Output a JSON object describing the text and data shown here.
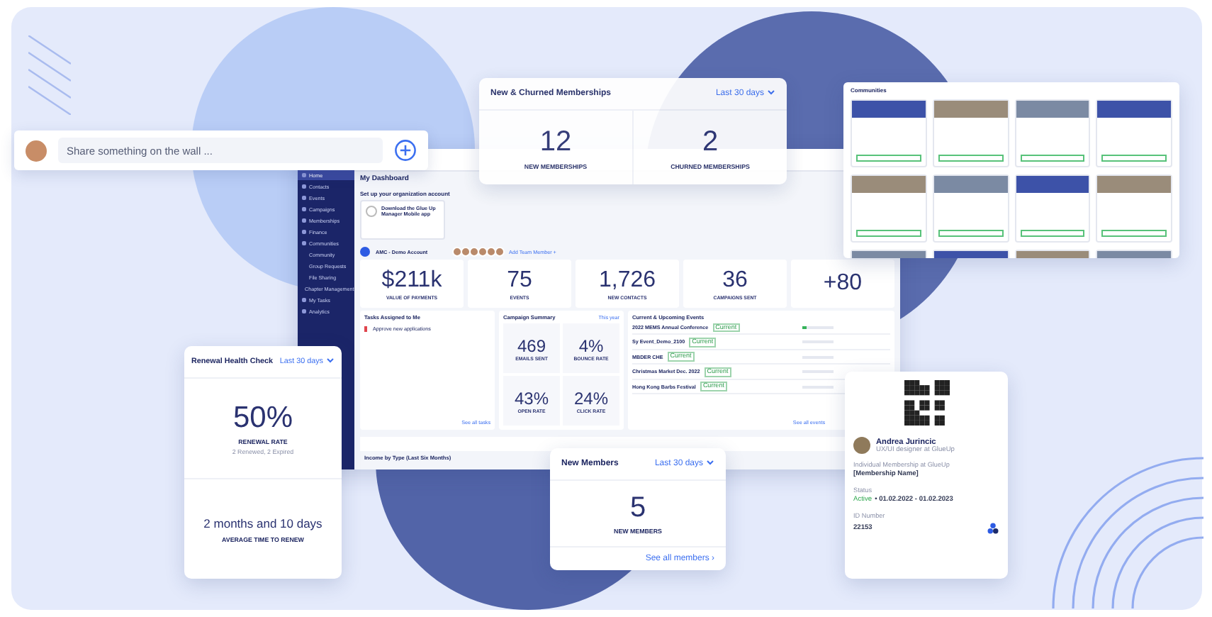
{
  "wall_post": {
    "placeholder": "Share something on the wall ..."
  },
  "churn_card": {
    "title": "New & Churned Memberships",
    "period": "Last 30 days",
    "stats": [
      {
        "value": "12",
        "label": "NEW MEMBERSHIPS"
      },
      {
        "value": "2",
        "label": "CHURNED MEMBERSHIPS"
      }
    ]
  },
  "dashboard": {
    "sidebar": {
      "items": [
        {
          "label": "Home",
          "selected": true
        },
        {
          "label": "Contacts",
          "selected": false
        },
        {
          "label": "Events",
          "selected": false
        },
        {
          "label": "Campaigns",
          "selected": false
        },
        {
          "label": "Memberships",
          "selected": false
        },
        {
          "label": "Finance",
          "selected": false
        },
        {
          "label": "Communities",
          "selected": false,
          "children": [
            {
              "label": "Community"
            },
            {
              "label": "Group Requests"
            },
            {
              "label": "File Sharing"
            }
          ]
        },
        {
          "label": "Chapter Management",
          "selected": false
        },
        {
          "label": "My Tasks",
          "selected": false
        },
        {
          "label": "Analytics",
          "selected": false
        }
      ]
    },
    "title": "My Dashboard",
    "setup": {
      "title": "Set up your organization account",
      "task": "Download the Glue Up Manager Mobile app"
    },
    "account": {
      "name": "AMC - Demo Account",
      "add_member": "Add Team Member +"
    },
    "stats": [
      {
        "value": "$211k",
        "label": "VALUE OF PAYMENTS"
      },
      {
        "value": "75",
        "label": "EVENTS"
      },
      {
        "value": "1,726",
        "label": "NEW CONTACTS"
      },
      {
        "value": "36",
        "label": "CAMPAIGNS SENT"
      },
      {
        "value": "+80"
      }
    ],
    "tasks": {
      "title": "Tasks Assigned to Me",
      "items": [
        {
          "title": "Approve new applications"
        }
      ],
      "link": "See all tasks"
    },
    "campaign": {
      "title": "Campaign Summary",
      "period": "This year",
      "stats": [
        {
          "value": "469",
          "label": "EMAILS SENT"
        },
        {
          "value": "4%",
          "label": "BOUNCE RATE"
        },
        {
          "value": "43%",
          "label": "OPEN RATE"
        },
        {
          "value": "24%",
          "label": "CLICK RATE"
        }
      ]
    },
    "events": {
      "title": "Current & Upcoming Events",
      "items": [
        {
          "name": "2022 MEMS Annual Conference",
          "status": "Current",
          "level": 0.15
        },
        {
          "name": "Sy Event_Demo_2100",
          "status": "Current"
        },
        {
          "name": "MBDER CHE",
          "status": "Current"
        },
        {
          "name": "Christmas Market Dec. 2022",
          "status": "Current"
        },
        {
          "name": "Hong Kong Barbs Festival",
          "status": "Current"
        }
      ],
      "link": "See all events"
    },
    "income": {
      "title": "Income by Type (Last Six Months)"
    }
  },
  "communities": {
    "title": "Communities"
  },
  "renewal": {
    "title": "Renewal Health Check",
    "period": "Last 30 days",
    "value": "50%",
    "label": "RENEWAL RATE",
    "sub": "2 Renewed, 2 Expired",
    "time": "2 months and 10 days",
    "time_label": "AVERAGE TIME TO RENEW"
  },
  "new_members": {
    "title": "New Members",
    "period": "Last 30 days",
    "value": "5",
    "label": "NEW MEMBERS",
    "link": "See all members ›"
  },
  "member_card": {
    "name": "Andrea Jurincic",
    "role": "UX/UI designer at GlueUp",
    "membership_type": "Individual Membership at GlueUp",
    "membership_name": "[Membership Name]",
    "status_label": "Status",
    "status": "Active",
    "active": true,
    "dates": "• 01.02.2022 - 01.02.2023",
    "id_label": "ID Number",
    "id": "22153"
  }
}
